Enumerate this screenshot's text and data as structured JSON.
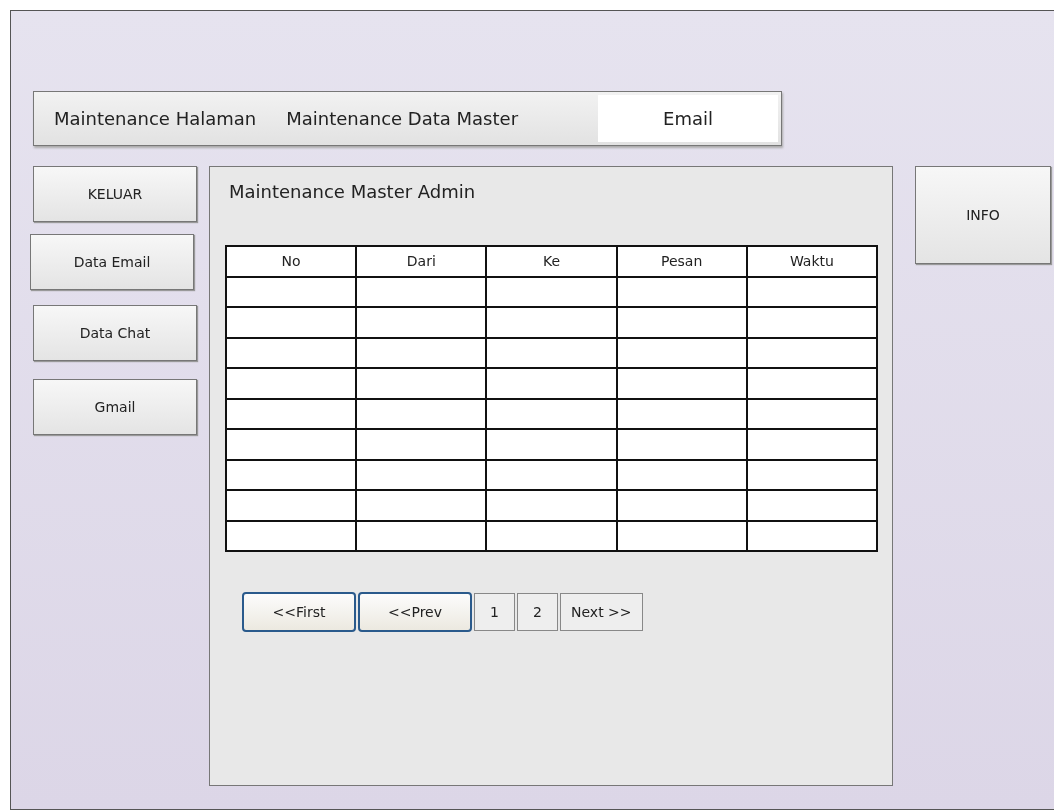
{
  "nav_tabs": [
    {
      "label": "Maintenance Halaman",
      "selected": false
    },
    {
      "label": "Maintenance Data Master",
      "selected": false
    },
    {
      "label": "Email",
      "selected": true
    }
  ],
  "sidebar": {
    "buttons": [
      "KELUAR",
      "Data Email",
      "Data Chat",
      "Gmail"
    ]
  },
  "panel": {
    "title": "Maintenance Master Admin",
    "table": {
      "columns": [
        "No",
        "Dari",
        "Ke",
        "Pesan",
        "Waktu"
      ]
    },
    "pagination": [
      {
        "label": "<<First",
        "kind": "nav"
      },
      {
        "label": "<<Prev",
        "kind": "nav"
      },
      {
        "label": "1",
        "kind": "page"
      },
      {
        "label": "2",
        "kind": "page"
      },
      {
        "label": "Next >>",
        "kind": "page"
      }
    ]
  },
  "info_button": "INFO"
}
